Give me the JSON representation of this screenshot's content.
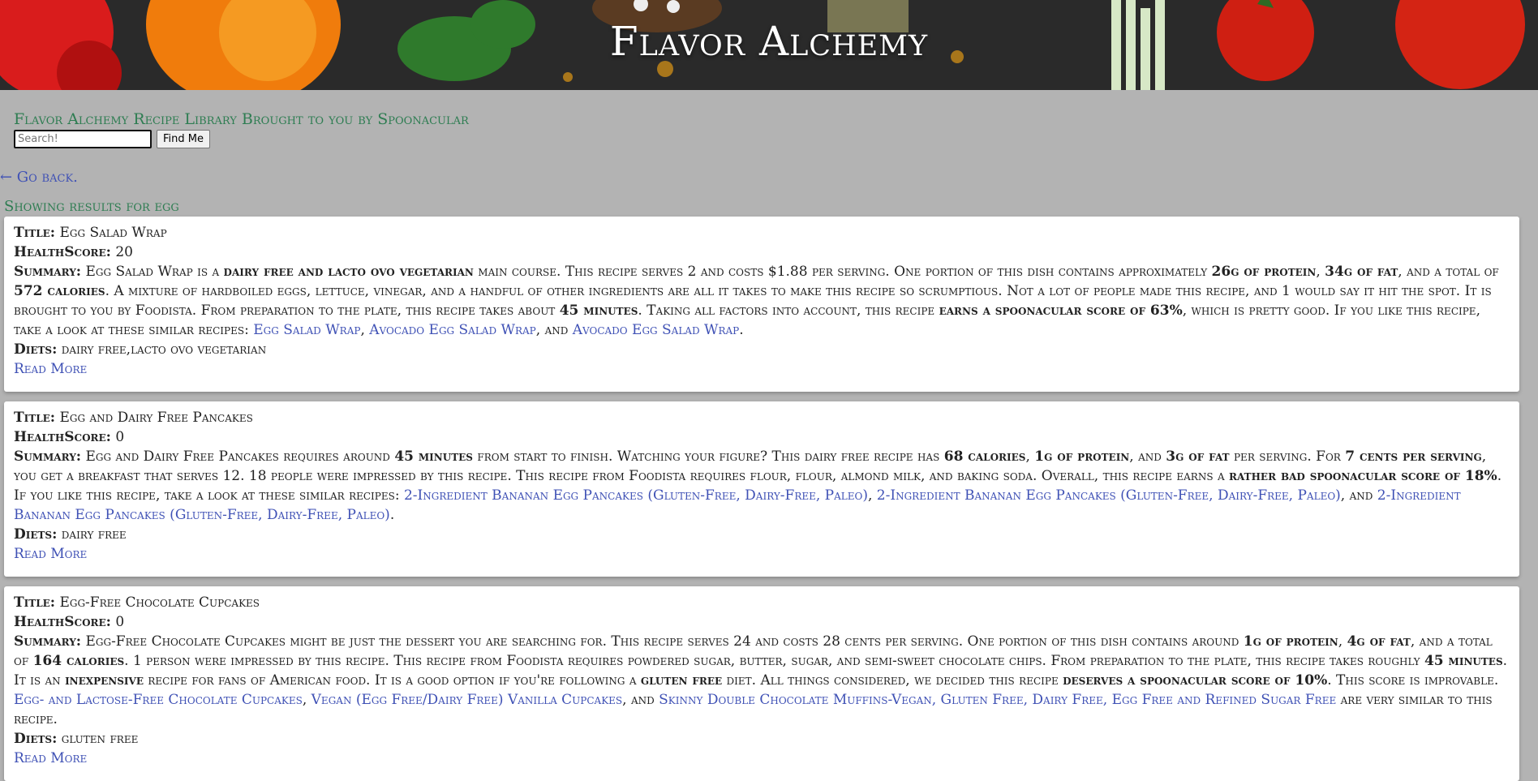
{
  "header": {
    "title": "Flavor Alchemy"
  },
  "library_title": "Flavor Alchemy Recipe Library Brought to you by Spoonacular",
  "search": {
    "placeholder": "Search!",
    "button_label": "Find Me"
  },
  "go_back": "← Go back.",
  "showing": "Showing results for egg",
  "labels": {
    "title": "Title:",
    "health": "HealthScore:",
    "summary": "Summary:",
    "diets": "Diets:",
    "read_more": "Read More"
  },
  "results": [
    {
      "title": "Egg Salad Wrap",
      "health": "20",
      "summary": [
        {
          "t": "Egg Salad Wrap is a "
        },
        {
          "t": "dairy free and lacto ovo vegetarian",
          "b": true
        },
        {
          "t": " main course. This recipe serves 2 and costs $1.88 per serving. One portion of this dish contains approximately "
        },
        {
          "t": "26g of protein",
          "b": true
        },
        {
          "t": ", "
        },
        {
          "t": "34g of fat",
          "b": true
        },
        {
          "t": ", and a total of "
        },
        {
          "t": "572 calories",
          "b": true
        },
        {
          "t": ". A mixture of hardboiled eggs, lettuce, vinegar, and a handful of other ingredients are all it takes to make this recipe so scrumptious. Not a lot of people made this recipe, and 1 would say it hit the spot. It is brought to you by Foodista. From preparation to the plate, this recipe takes about "
        },
        {
          "t": "45 minutes",
          "b": true
        },
        {
          "t": ". Taking all factors into account, this recipe "
        },
        {
          "t": "earns a spoonacular score of 63%",
          "b": true
        },
        {
          "t": ", which is pretty good. If you like this recipe, take a look at these similar recipes: "
        },
        {
          "t": "Egg Salad Wrap",
          "a": true
        },
        {
          "t": ", "
        },
        {
          "t": "Avocado Egg Salad Wrap",
          "a": true
        },
        {
          "t": ", and "
        },
        {
          "t": "Avocado Egg Salad Wrap",
          "a": true
        },
        {
          "t": "."
        }
      ],
      "diets": "dairy free,lacto ovo vegetarian"
    },
    {
      "title": "Egg and Dairy Free Pancakes",
      "health": "0",
      "summary": [
        {
          "t": "Egg and Dairy Free Pancakes requires around "
        },
        {
          "t": "45 minutes",
          "b": true
        },
        {
          "t": " from start to finish. Watching your figure? This dairy free recipe has "
        },
        {
          "t": "68 calories",
          "b": true
        },
        {
          "t": ", "
        },
        {
          "t": "1g of protein",
          "b": true
        },
        {
          "t": ", and "
        },
        {
          "t": "3g of fat",
          "b": true
        },
        {
          "t": " per serving. For "
        },
        {
          "t": "7 cents per serving",
          "b": true
        },
        {
          "t": ", you get a breakfast that serves 12. 18 people were impressed by this recipe. This recipe from Foodista requires flour, flour, almond milk, and baking soda. Overall, this recipe earns a "
        },
        {
          "t": "rather bad spoonacular score of 18%",
          "b": true
        },
        {
          "t": ". If you like this recipe, take a look at these similar recipes: "
        },
        {
          "t": "2-Ingredient Bananan Egg Pancakes (Gluten-Free, Dairy-Free, Paleo)",
          "a": true
        },
        {
          "t": ", "
        },
        {
          "t": "2-Ingredient Bananan Egg Pancakes (Gluten-Free, Dairy-Free, Paleo)",
          "a": true
        },
        {
          "t": ", and "
        },
        {
          "t": "2-Ingredient Bananan Egg Pancakes (Gluten-Free, Dairy-Free, Paleo)",
          "a": true
        },
        {
          "t": "."
        }
      ],
      "diets": "dairy free"
    },
    {
      "title": "Egg-Free Chocolate Cupcakes",
      "health": "0",
      "summary": [
        {
          "t": "Egg-Free Chocolate Cupcakes might be just the dessert you are searching for. This recipe serves 24 and costs 28 cents per serving. One portion of this dish contains around "
        },
        {
          "t": "1g of protein",
          "b": true
        },
        {
          "t": ", "
        },
        {
          "t": "4g of fat",
          "b": true
        },
        {
          "t": ", and a total of "
        },
        {
          "t": "164 calories",
          "b": true
        },
        {
          "t": ". 1 person were impressed by this recipe. This recipe from Foodista requires powdered sugar, butter, sugar, and semi-sweet chocolate chips. From preparation to the plate, this recipe takes roughly "
        },
        {
          "t": "45 minutes",
          "b": true
        },
        {
          "t": ". It is an "
        },
        {
          "t": "inexpensive",
          "b": true
        },
        {
          "t": " recipe for fans of American food. It is a good option if you're following a "
        },
        {
          "t": "gluten free",
          "b": true
        },
        {
          "t": " diet. All things considered, we decided this recipe "
        },
        {
          "t": "deserves a spoonacular score of 10%",
          "b": true
        },
        {
          "t": ". This score is improvable. "
        },
        {
          "t": "Egg- and Lactose-Free Chocolate Cupcakes",
          "a": true
        },
        {
          "t": ", "
        },
        {
          "t": "Vegan (Egg Free/Dairy Free) Vanilla Cupcakes",
          "a": true
        },
        {
          "t": ", and "
        },
        {
          "t": "Skinny Double Chocolate Muffins-Vegan, Gluten Free, Dairy Free, Egg Free and Refined Sugar Free",
          "a": true
        },
        {
          "t": " are very similar to this recipe."
        }
      ],
      "diets": "gluten free"
    }
  ]
}
